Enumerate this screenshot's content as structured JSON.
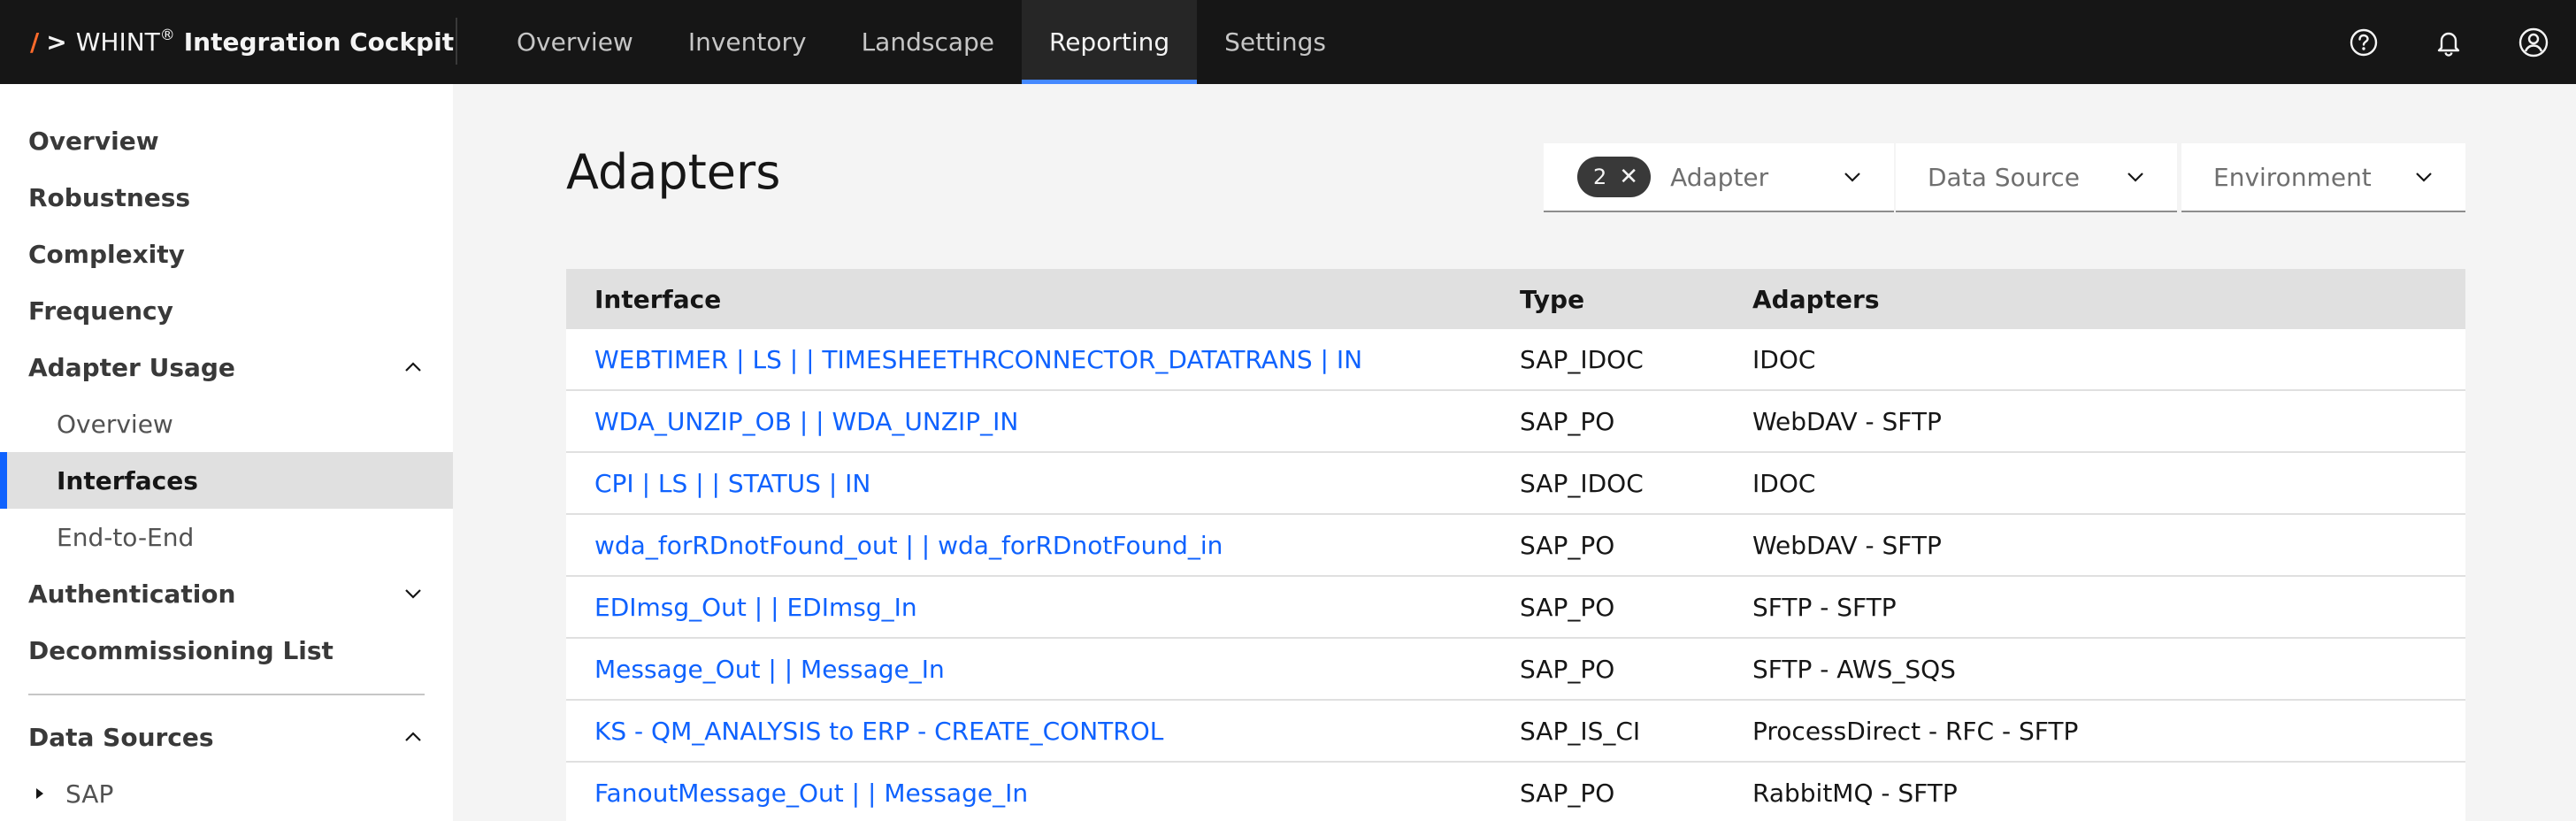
{
  "header": {
    "brand_slash": "/",
    "brand_gt": ">",
    "brand_name": "WHINT",
    "brand_reg": "®",
    "brand_product": "Integration Cockpit",
    "nav": [
      {
        "label": "Overview",
        "active": false
      },
      {
        "label": "Inventory",
        "active": false
      },
      {
        "label": "Landscape",
        "active": false
      },
      {
        "label": "Reporting",
        "active": true
      },
      {
        "label": "Settings",
        "active": false
      }
    ],
    "icons": [
      "help-icon",
      "notification-icon",
      "user-avatar-icon"
    ]
  },
  "sidebar": {
    "items": [
      {
        "label": "Overview"
      },
      {
        "label": "Robustness"
      },
      {
        "label": "Complexity"
      },
      {
        "label": "Frequency"
      },
      {
        "label": "Adapter Usage",
        "expanded": true
      },
      {
        "label": "Overview"
      },
      {
        "label": "Interfaces",
        "active": true
      },
      {
        "label": "End-to-End"
      },
      {
        "label": "Authentication",
        "expanded": false
      },
      {
        "label": "Decommissioning List"
      },
      {
        "label": "Data Sources",
        "expanded": true
      },
      {
        "label": "SAP"
      }
    ]
  },
  "main": {
    "title": "Adapters",
    "filters": {
      "adapter": {
        "label": "Adapter",
        "count": "2"
      },
      "data_source": {
        "label": "Data Source"
      },
      "environment": {
        "label": "Environment"
      }
    },
    "table": {
      "columns": [
        "Interface",
        "Type",
        "Adapters"
      ],
      "rows": [
        {
          "interface": "WEBTIMER | LS | | TIMESHEETHRCONNECTOR_DATATRANS | IN",
          "type": "SAP_IDOC",
          "adapters": "IDOC"
        },
        {
          "interface": "WDA_UNZIP_OB | | WDA_UNZIP_IN",
          "type": "SAP_PO",
          "adapters": "WebDAV - SFTP"
        },
        {
          "interface": "CPI | LS | | STATUS | IN",
          "type": "SAP_IDOC",
          "adapters": "IDOC"
        },
        {
          "interface": "wda_forRDnotFound_out | | wda_forRDnotFound_in",
          "type": "SAP_PO",
          "adapters": "WebDAV - SFTP"
        },
        {
          "interface": "EDImsg_Out | | EDImsg_In",
          "type": "SAP_PO",
          "adapters": "SFTP - SFTP"
        },
        {
          "interface": "Message_Out | | Message_In",
          "type": "SAP_PO",
          "adapters": "SFTP - AWS_SQS"
        },
        {
          "interface": "KS - QM_ANALYSIS to ERP - CREATE_CONTROL",
          "type": "SAP_IS_CI",
          "adapters": "ProcessDirect - RFC - SFTP"
        },
        {
          "interface": "FanoutMessage_Out | | Message_In",
          "type": "SAP_PO",
          "adapters": "RabbitMQ - SFTP"
        }
      ]
    }
  },
  "colors": {
    "header_bg": "#161616",
    "accent": "#0f62fe",
    "brand_slash": "#ff6b2b",
    "nav_active_underline": "#4589ff"
  }
}
